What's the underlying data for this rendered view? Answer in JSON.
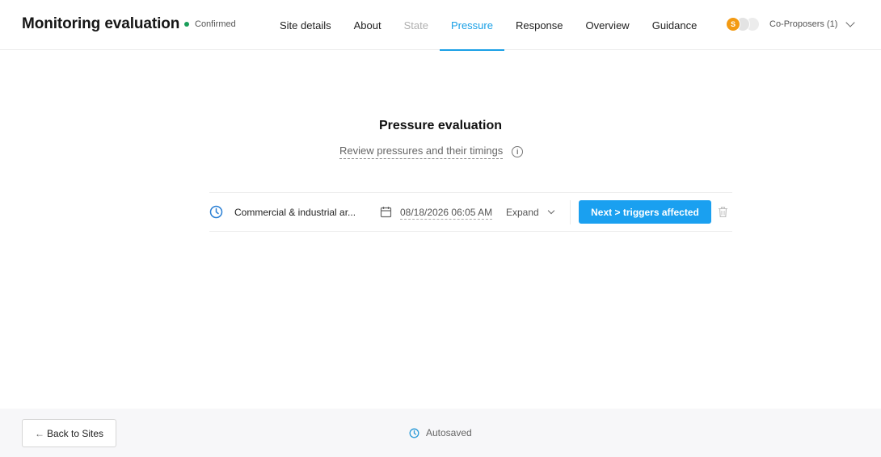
{
  "header": {
    "title": "Monitoring evaluation",
    "status": {
      "label": "Confirmed",
      "color": "#1a9e5a"
    },
    "tabs": [
      {
        "label": "Site details",
        "state": "normal"
      },
      {
        "label": "About",
        "state": "normal"
      },
      {
        "label": "State",
        "state": "disabled"
      },
      {
        "label": "Pressure",
        "state": "active"
      },
      {
        "label": "Response",
        "state": "normal"
      },
      {
        "label": "Overview",
        "state": "normal"
      },
      {
        "label": "Guidance",
        "state": "normal"
      }
    ],
    "proposers": {
      "avatar_initial": "S",
      "label": "Co-Proposers (1)"
    }
  },
  "main": {
    "title": "Pressure evaluation",
    "subtitle": "Review pressures and their timings",
    "pressure_row": {
      "name": "Commercial & industrial ar...",
      "date": "08/18/2026 06:05 AM",
      "expand_label": "Expand",
      "next_button": "Next > triggers affected"
    }
  },
  "footer": {
    "back_button": "Back to Sites",
    "autosave": "Autosaved"
  },
  "colors": {
    "accent": "#1aa0f0",
    "avatar": "#f39a12"
  },
  "icons": [
    "dot-icon",
    "chevron-down-icon",
    "info-icon",
    "clock-icon",
    "calendar-icon",
    "trash-icon",
    "arrow-left-icon"
  ]
}
